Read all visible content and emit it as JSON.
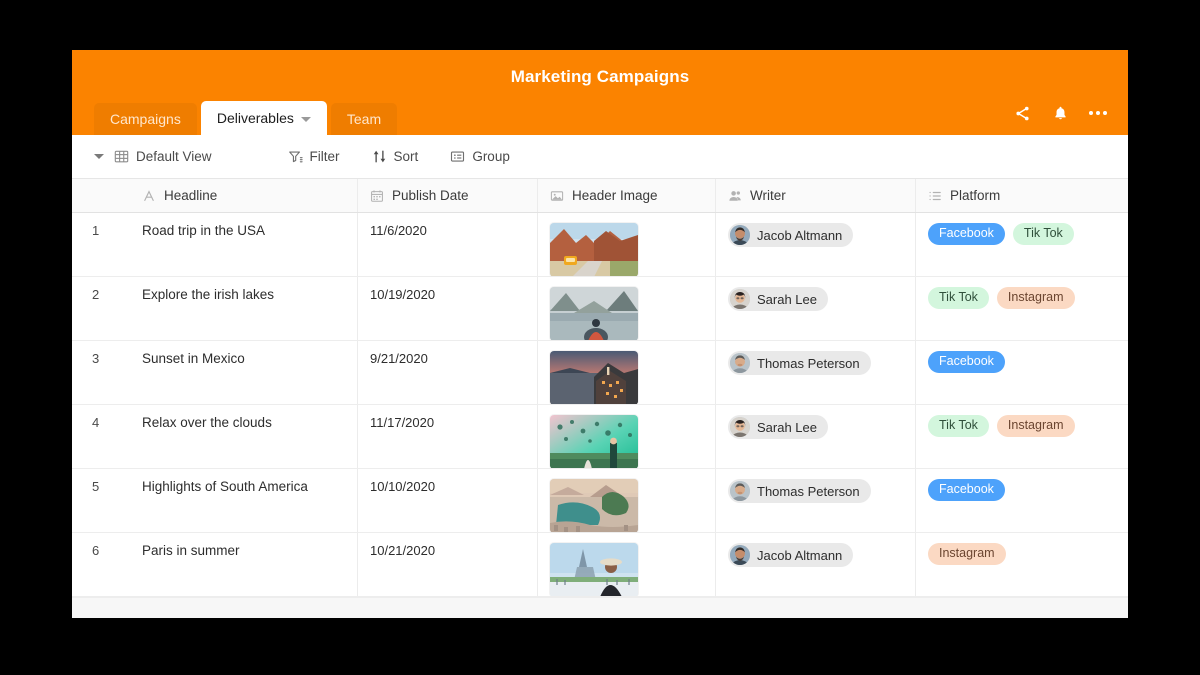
{
  "window": {
    "title": "Marketing Campaigns",
    "accent_color": "#fb8300",
    "tab_inactive_color": "#ef7d00"
  },
  "header_actions": [
    {
      "name": "share-icon",
      "label": "Share"
    },
    {
      "name": "notifications-icon",
      "label": "Notifications"
    },
    {
      "name": "more-options-icon",
      "label": "More options"
    }
  ],
  "tabs": [
    {
      "label": "Campaigns",
      "active": false,
      "caret": false
    },
    {
      "label": "Deliverables",
      "active": true,
      "caret": true
    },
    {
      "label": "Team",
      "active": false,
      "caret": false
    }
  ],
  "toolbar": {
    "view_name": "Default View",
    "filter_label": "Filter",
    "sort_label": "Sort",
    "group_label": "Group"
  },
  "grid": {
    "columns": [
      {
        "label": "",
        "icon": "row-number",
        "key": "num"
      },
      {
        "label": "Headline",
        "icon": "text-icon",
        "key": "head"
      },
      {
        "label": "Publish Date",
        "icon": "calendar-icon",
        "key": "date"
      },
      {
        "label": "Header Image",
        "icon": "image-icon",
        "key": "img"
      },
      {
        "label": "Writer",
        "icon": "person-icon",
        "key": "writer"
      },
      {
        "label": "Platform",
        "icon": "list-icon",
        "key": "plat"
      }
    ],
    "rows": [
      {
        "num": "1",
        "headline": "Road trip in the USA",
        "publish_date": "11/6/2020",
        "image": "road-trip-canyon-van",
        "writer": "Jacob Altmann",
        "platforms": [
          "Facebook",
          "Tik Tok"
        ]
      },
      {
        "num": "2",
        "headline": "Explore the irish lakes",
        "publish_date": "10/19/2020",
        "image": "lake-mountains-hiker",
        "writer": "Sarah Lee",
        "platforms": [
          "Tik Tok",
          "Instagram"
        ]
      },
      {
        "num": "3",
        "headline": "Sunset in Mexico",
        "publish_date": "9/21/2020",
        "image": "coastal-sunset-village",
        "writer": "Thomas Peterson",
        "platforms": [
          "Facebook"
        ]
      },
      {
        "num": "4",
        "headline": "Relax over the clouds",
        "publish_date": "11/17/2020",
        "image": "balloons-field-couple",
        "writer": "Sarah Lee",
        "platforms": [
          "Tik Tok",
          "Instagram"
        ]
      },
      {
        "num": "5",
        "headline": "Highlights of South America",
        "publish_date": "10/10/2020",
        "image": "rio-bay-aerial",
        "writer": "Thomas Peterson",
        "platforms": [
          "Facebook"
        ]
      },
      {
        "num": "6",
        "headline": "Paris in summer",
        "publish_date": "10/21/2020",
        "image": "eiffel-tower-woman",
        "writer": "Jacob Altmann",
        "platforms": [
          "Instagram"
        ]
      }
    ]
  },
  "platform_colors": {
    "Facebook": {
      "bg": "#4da2fb",
      "fg": "#ffffff"
    },
    "Tik Tok": {
      "bg": "#d3f6dd",
      "fg": "#2f4f3a"
    },
    "Instagram": {
      "bg": "#fbd9c3",
      "fg": "#6b4530"
    }
  }
}
